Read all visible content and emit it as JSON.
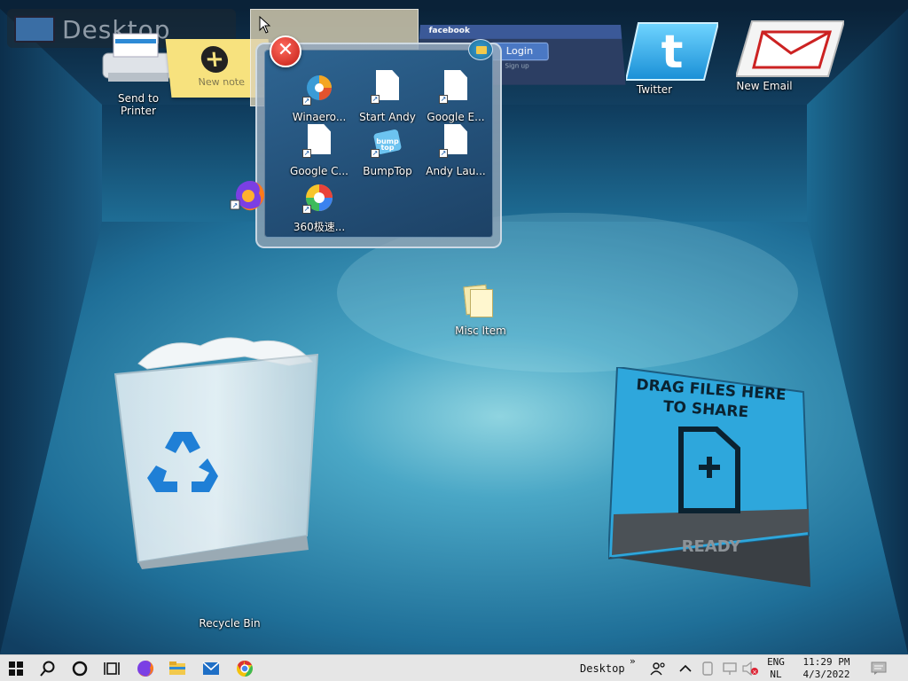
{
  "app": {
    "title": "Desktop"
  },
  "top_widgets": {
    "send_to_printer": "Send to\nPrinter",
    "new_note": "New note",
    "facebook": {
      "brand": "facebook",
      "login": "Login",
      "signup": "Sign up"
    },
    "twitter": "Twitter",
    "new_email": "New Email"
  },
  "pile": {
    "items": [
      {
        "label": "Winaero...",
        "icon": "winaero-icon"
      },
      {
        "label": "Start Andy",
        "icon": "document-shortcut-icon"
      },
      {
        "label": "Google E...",
        "icon": "document-shortcut-icon"
      },
      {
        "label": "Google C...",
        "icon": "document-shortcut-icon"
      },
      {
        "label": "BumpTop",
        "icon": "bumptop-icon"
      },
      {
        "label": "Andy Lau...",
        "icon": "document-shortcut-icon"
      },
      {
        "label": "360极速...",
        "icon": "360-browser-icon"
      }
    ]
  },
  "desktop": {
    "misc_item": "Misc Item",
    "recycle_bin": "Recycle Bin",
    "share_box": {
      "line1": "DRAG FILES HERE",
      "line2": "TO SHARE",
      "status": "READY"
    }
  },
  "taskbar": {
    "pinned": [
      "start-icon",
      "search-icon",
      "cortana-icon",
      "task-view-icon",
      "firefox-icon",
      "file-explorer-icon",
      "mail-icon",
      "chrome-icon"
    ],
    "toolbar_label": "Desktop",
    "toolbar_chevron": "»",
    "lang_top": "ENG",
    "lang_bottom": "NL",
    "time": "11:29 PM",
    "date": "4/3/2022"
  },
  "colors": {
    "room_center": "#4fb3cf",
    "room_edge": "#0e3857",
    "taskbar": "#e6e6e6",
    "share_blue": "#2ea7dc",
    "note_yellow": "#f7e27e"
  }
}
